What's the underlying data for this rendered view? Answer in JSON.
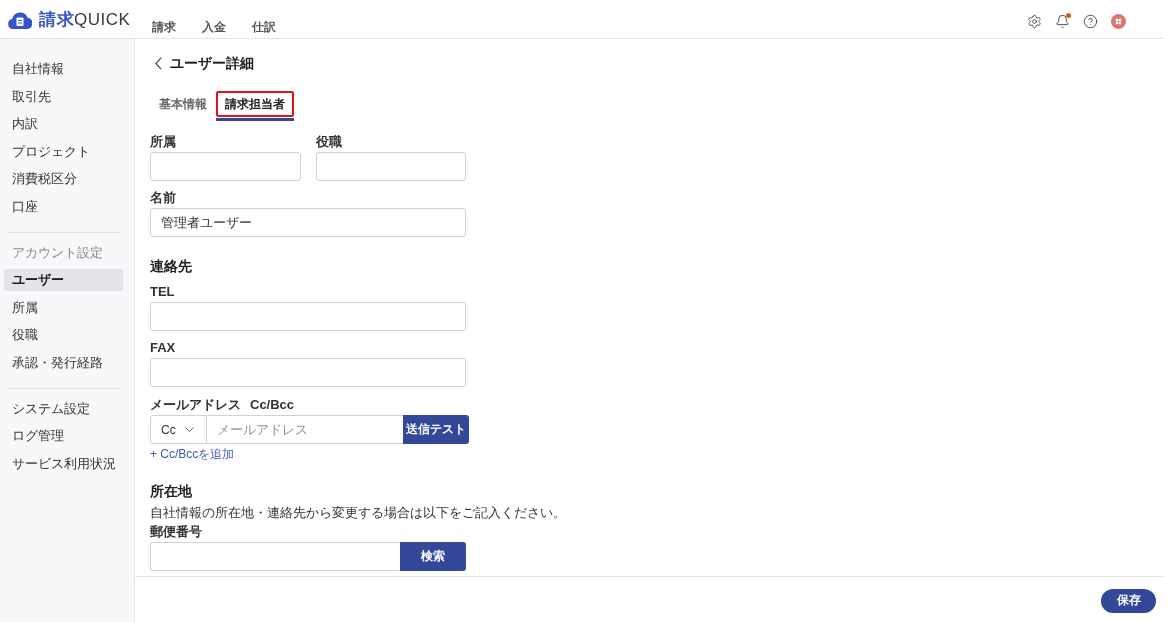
{
  "header": {
    "brand": {
      "prefix": "請求",
      "name": "QUICK"
    },
    "nav": [
      {
        "label": "請求"
      },
      {
        "label": "入金"
      },
      {
        "label": "仕訳"
      }
    ],
    "notifications": {
      "unread": true
    }
  },
  "sidebar": {
    "groups": [
      {
        "items": [
          {
            "label": "自社情報",
            "selected": false
          },
          {
            "label": "取引先",
            "selected": false
          },
          {
            "label": "内訳",
            "selected": false
          },
          {
            "label": "プロジェクト",
            "selected": false
          },
          {
            "label": "消費税区分",
            "selected": false
          },
          {
            "label": "口座",
            "selected": false
          }
        ]
      },
      {
        "heading": "アカウント設定",
        "items": [
          {
            "label": "ユーザー",
            "selected": true
          },
          {
            "label": "所属",
            "selected": false
          },
          {
            "label": "役職",
            "selected": false
          },
          {
            "label": "承認・発行経路",
            "selected": false
          }
        ]
      },
      {
        "items": [
          {
            "label": "システム設定",
            "selected": false
          },
          {
            "label": "ログ管理",
            "selected": false
          },
          {
            "label": "サービス利用状況",
            "selected": false
          }
        ]
      }
    ]
  },
  "page": {
    "title": "ユーザー詳細",
    "tabs": [
      {
        "label": "基本情報",
        "selected": false,
        "highlighted": false
      },
      {
        "label": "請求担当者",
        "selected": true,
        "highlighted": true
      }
    ]
  },
  "form": {
    "rows": [
      {
        "kind": "pair",
        "fields": [
          {
            "label": "所属"
          },
          {
            "label": "役職"
          }
        ]
      },
      {
        "kind": "text",
        "label": "名前",
        "value": "管理者ユーザー"
      },
      {
        "kind": "heading",
        "text": "連絡先"
      },
      {
        "kind": "text",
        "label": "TEL"
      },
      {
        "kind": "text",
        "label": "FAX"
      },
      {
        "kind": "email",
        "label": "メールアドレス",
        "label_note": "Cc/Bcc",
        "select": "Cc",
        "placeholder": "メールアドレス",
        "button": "送信テスト",
        "add_link": "+ Cc/Bccを追加"
      },
      {
        "kind": "heading",
        "text": "所在地"
      },
      {
        "kind": "note",
        "text": "自社情報の所在地・連絡先から変更する場合は以下をご記入ください。"
      },
      {
        "kind": "search",
        "label": "郵便番号",
        "button": "検索"
      }
    ]
  },
  "footer": {
    "save": "保存"
  }
}
